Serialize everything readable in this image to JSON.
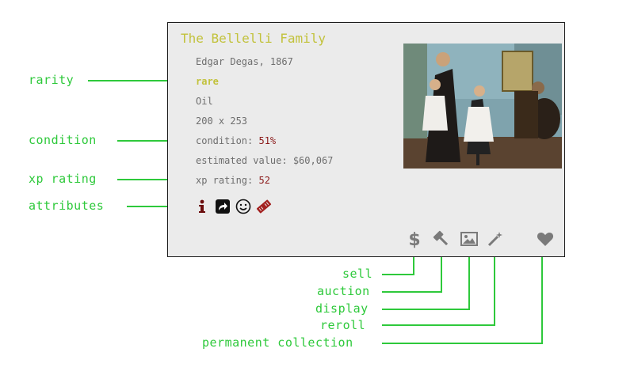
{
  "card": {
    "title": "The Bellelli Family",
    "artist_year": "Edgar Degas, 1867",
    "rarity": "rare",
    "medium": "Oil",
    "dimensions": "200 x 253",
    "condition_label": "condition: ",
    "condition_value": "51%",
    "value_label": "estimated value: $60,067",
    "xp_label": "xp rating: ",
    "xp_value": "52"
  },
  "attributes": [
    "info-icon",
    "share-arrow-icon",
    "smiley-icon",
    "ticket-icon"
  ],
  "actions": [
    "dollar-icon",
    "gavel-icon",
    "image-icon",
    "magic-wand-icon",
    "heart-icon"
  ],
  "callouts": {
    "rarity": "rarity",
    "condition": "condition",
    "xp_rating": "xp rating",
    "attributes": "attributes",
    "sell": "sell",
    "auction": "auction",
    "display": "display",
    "reroll": "reroll",
    "permanent_collection": "permanent collection"
  },
  "colors": {
    "callout": "#2ec93b",
    "title": "#c2c23c",
    "accent_red": "#8b1a1a",
    "card_bg": "#ebebeb",
    "icon_gray": "#7a7a7a"
  }
}
